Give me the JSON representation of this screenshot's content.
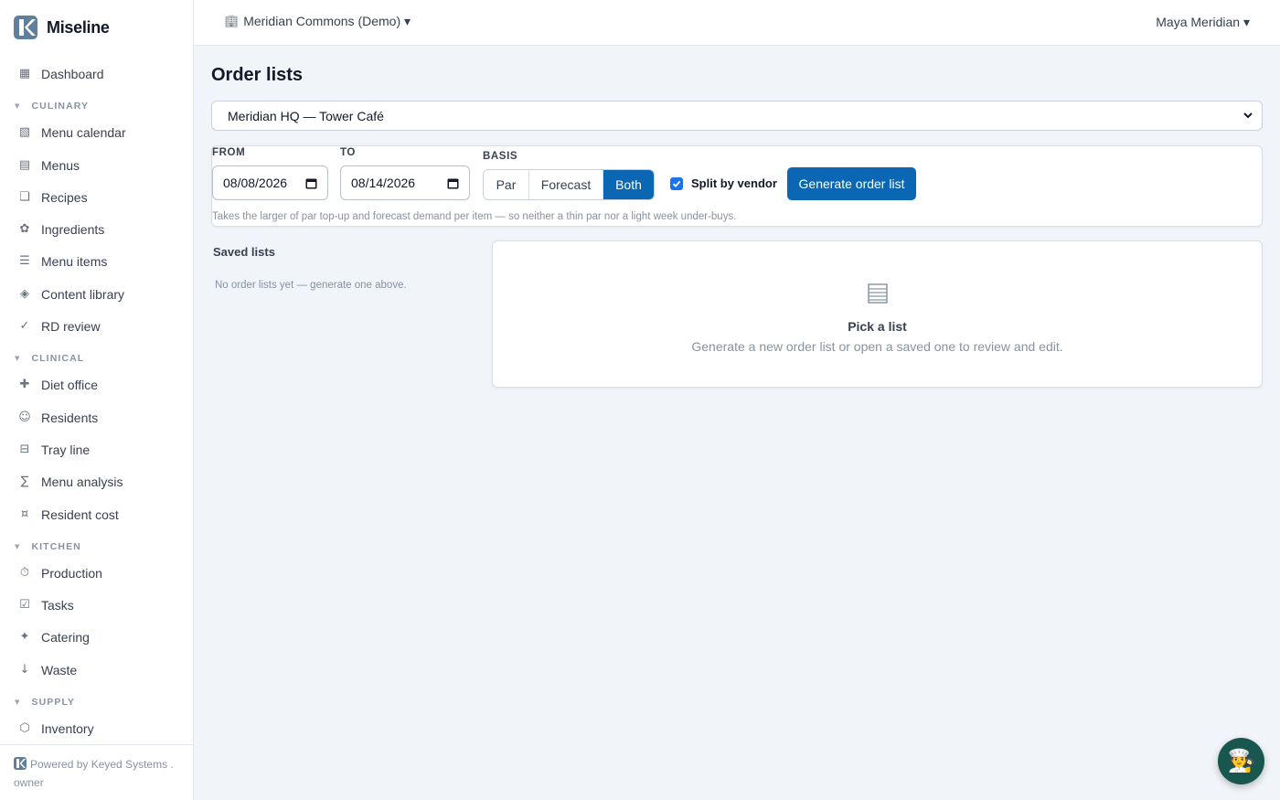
{
  "app": {
    "name": "Miseline"
  },
  "sidebar": {
    "dashboard": {
      "label": "Dashboard",
      "icon": "grid-icon"
    },
    "sections": [
      {
        "title": "CULINARY",
        "items": [
          {
            "label": "Menu calendar",
            "icon": "calendar-icon"
          },
          {
            "label": "Menus",
            "icon": "menu-list-icon"
          },
          {
            "label": "Recipes",
            "icon": "recipe-card-icon"
          },
          {
            "label": "Ingredients",
            "icon": "flower-icon"
          },
          {
            "label": "Menu items",
            "icon": "lines-icon"
          },
          {
            "label": "Content library",
            "icon": "diamond-icon"
          },
          {
            "label": "RD review",
            "icon": "check-icon"
          }
        ]
      },
      {
        "title": "CLINICAL",
        "items": [
          {
            "label": "Diet office",
            "icon": "plus-icon"
          },
          {
            "label": "Residents",
            "icon": "smiley-icon"
          },
          {
            "label": "Tray line",
            "icon": "tray-icon"
          },
          {
            "label": "Menu analysis",
            "icon": "sigma-icon"
          },
          {
            "label": "Resident cost",
            "icon": "currency-icon"
          }
        ]
      },
      {
        "title": "KITCHEN",
        "items": [
          {
            "label": "Production",
            "icon": "stopwatch-icon"
          },
          {
            "label": "Tasks",
            "icon": "checkbox-icon"
          },
          {
            "label": "Catering",
            "icon": "sparkle-icon"
          },
          {
            "label": "Waste",
            "icon": "down-arrow-icon"
          }
        ]
      },
      {
        "title": "SUPPLY",
        "items": [
          {
            "label": "Inventory",
            "icon": "hexagon-icon"
          }
        ]
      }
    ],
    "footer": {
      "powered_by": "Powered by Keyed Systems .",
      "role": "owner"
    }
  },
  "topbar": {
    "org": "Meridian Commons (Demo) ▾",
    "user": "Maya Meridian ▾"
  },
  "page": {
    "title": "Order lists",
    "location": "Meridian HQ — Tower Café",
    "filters": {
      "from_label": "FROM",
      "from_value": "08/08/2026",
      "to_label": "TO",
      "to_value": "08/14/2026",
      "basis_label": "BASIS",
      "basis_options": [
        "Par",
        "Forecast",
        "Both"
      ],
      "basis_selected": "Both",
      "split_by_vendor_label": "Split by vendor",
      "split_by_vendor_checked": true,
      "generate_label": "Generate order list",
      "hint": "Takes the larger of par top-up and forecast demand per item — so neither a thin par nor a light week under-buys."
    },
    "saved": {
      "title": "Saved lists",
      "empty": "No order lists yet — generate one above."
    },
    "preview": {
      "title": "Pick a list",
      "subtitle": "Generate a new order list or open a saved one to review and edit."
    }
  },
  "colors": {
    "accent": "#0b66b3",
    "checkbox": "#1a73e8",
    "fab": "#17574f"
  },
  "fab": {
    "emoji": "🧑‍🍳",
    "icon": "chef-icon"
  }
}
